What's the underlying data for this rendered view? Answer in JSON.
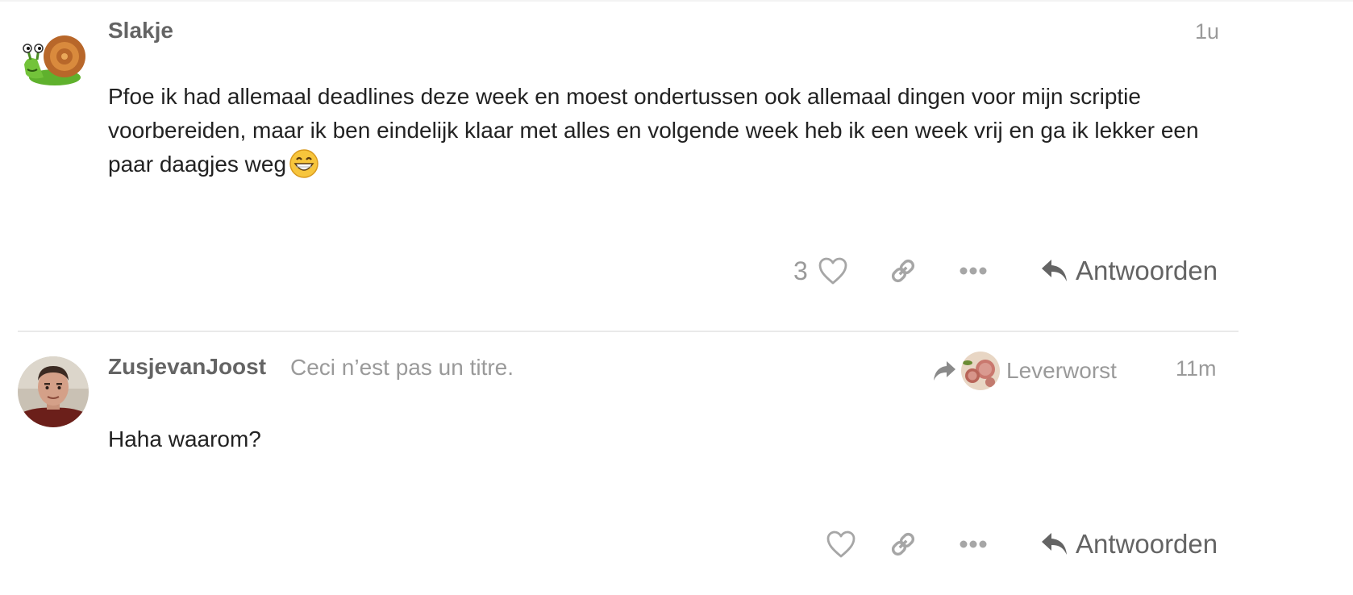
{
  "posts": [
    {
      "username": "Slakje",
      "user_title": "",
      "date": "1u",
      "avatar_icon": "snail-avatar",
      "body_text": "Pfoe ik had allemaal deadlines deze week en moest ondertussen ook allemaal dingen voor mijn scriptie voorbereiden, maar ik ben eindelijk klaar met alles en volgende week heb ik een week vrij en ga ik lekker een paar daagjes weg",
      "body_emoji": "grinning-face-emoji",
      "like_count": "3",
      "reply_label": "Antwoorden"
    },
    {
      "username": "ZusjevanJoost",
      "user_title": "Ceci n’est pas un titre.",
      "date": "11m",
      "avatar_icon": "man-portrait-avatar",
      "reply_to_name": "Leverworst",
      "body_text": "Haha waarom?",
      "like_count": "",
      "reply_label": "Antwoorden"
    }
  ],
  "colors": {
    "primary_text": "#222222",
    "username": "#646464",
    "muted": "#9a9a9a",
    "divider": "#e9e9e9"
  },
  "icons": {
    "like": "heart-icon",
    "link": "link-icon",
    "more": "ellipsis-icon",
    "reply": "reply-arrow-icon",
    "reply_to": "share-arrow-icon"
  }
}
